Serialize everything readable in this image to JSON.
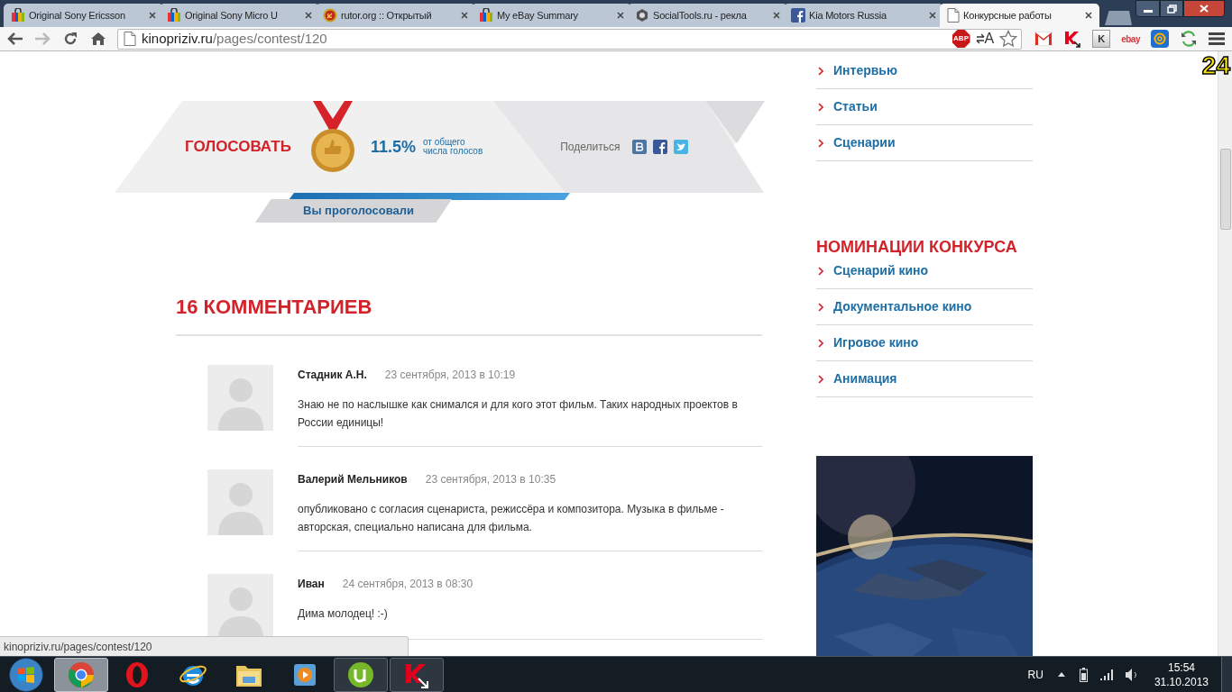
{
  "browser": {
    "tabs": [
      {
        "title": "Original Sony Ericsson",
        "kind": "shop",
        "selected": false
      },
      {
        "title": "Original Sony Micro U",
        "kind": "shop",
        "selected": false
      },
      {
        "title": "rutor.org :: Открытый",
        "kind": "star",
        "selected": false
      },
      {
        "title": "My eBay Summary",
        "kind": "shop",
        "selected": false
      },
      {
        "title": "SocialTools.ru - рекла",
        "kind": "hex",
        "selected": false
      },
      {
        "title": "Kia Motors Russia",
        "kind": "facebook",
        "selected": false
      },
      {
        "title": "Конкурсные работы",
        "kind": "page",
        "selected": true
      }
    ],
    "address": {
      "domain": "kinopriziv.ru",
      "path": "/pages/contest/120"
    },
    "extensions": [
      {
        "kind": "abp",
        "label": "ABP"
      },
      {
        "kind": "translate",
        "label": "A"
      },
      {
        "kind": "star"
      },
      {
        "kind": "gmail"
      },
      {
        "kind": "kaspersky"
      },
      {
        "kind": "key",
        "label": "K"
      },
      {
        "kind": "ebay",
        "label": "ebay"
      },
      {
        "kind": "mail"
      },
      {
        "kind": "sync"
      },
      {
        "kind": "menu"
      }
    ],
    "status_url": "kinopriziv.ru/pages/contest/120"
  },
  "overlay_counter": "24",
  "vote": {
    "button": "ГОЛОСОВАТЬ",
    "percent": "11.5%",
    "percent_caption": "от общего\nчисла голосов",
    "share_label": "Поделиться",
    "share": [
      {
        "kind": "vk"
      },
      {
        "kind": "facebook"
      },
      {
        "kind": "twitter"
      }
    ],
    "voted": "Вы проголосовали"
  },
  "comments": {
    "heading": "16 КОММЕНТАРИЕВ",
    "items": [
      {
        "author": "Стадник А.Н.",
        "date": "23 сентября, 2013 в 10:19",
        "text": "Знаю не по наслышке как снимался и для кого этот фильм. Таких народных проектов в России единицы!"
      },
      {
        "author": "Валерий Мельников",
        "date": "23 сентября, 2013 в 10:35",
        "text": "опубликовано с согласия сценариста, режиссёра и композитора. Музыка в фильме - авторская, специально написана для фильма."
      },
      {
        "author": "Иван",
        "date": "24 сентября, 2013 в 08:30",
        "text": "Дима молодец! :-)"
      }
    ]
  },
  "sidebar": {
    "links": [
      "Интервью",
      "Статьи",
      "Сценарии"
    ],
    "nominations_heading": "НОМИНАЦИИ КОНКУРСА",
    "nominations": [
      "Сценарий кино",
      "Документальное кино",
      "Игровое кино",
      "Анимация"
    ],
    "banner": {
      "kind": "picture"
    }
  },
  "taskbar": {
    "apps": [
      {
        "kind": "chrome",
        "selected": true,
        "running": true
      },
      {
        "kind": "opera",
        "selected": false,
        "running": false
      },
      {
        "kind": "ie",
        "selected": false,
        "running": false
      },
      {
        "kind": "explorer",
        "selected": false,
        "running": false
      },
      {
        "kind": "media",
        "selected": false,
        "running": false
      },
      {
        "kind": "utorrent",
        "selected": false,
        "running": true
      },
      {
        "kind": "kaspersky",
        "selected": false,
        "running": true
      }
    ],
    "language": "RU",
    "time": "15:54",
    "date": "31.10.2013"
  }
}
